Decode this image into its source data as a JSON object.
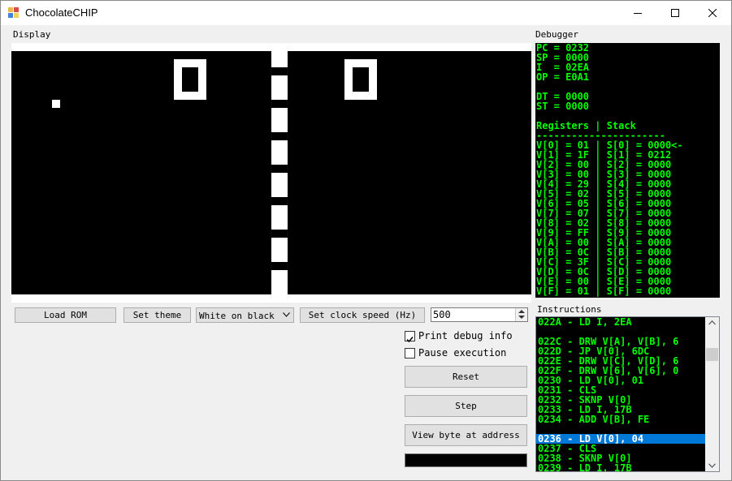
{
  "window": {
    "title": "ChocolateCHIP",
    "icon": "app-icon"
  },
  "sections": {
    "display": "Display",
    "debugger": "Debugger",
    "instructions": "Instructions"
  },
  "debugger": {
    "lines": [
      "PC = 0232",
      "SP = 0000",
      "I  = 02EA",
      "OP = E0A1",
      "",
      "DT = 0000",
      "ST = 0000",
      "",
      "Registers | Stack",
      "----------------------",
      "V[0] = 01 | S[0] = 0000<-",
      "V[1] = 1F | S[1] = 0212",
      "V[2] = 00 | S[2] = 0000",
      "V[3] = 00 | S[3] = 0000",
      "V[4] = 29 | S[4] = 0000",
      "V[5] = 02 | S[5] = 0000",
      "V[6] = 05 | S[6] = 0000",
      "V[7] = 07 | S[7] = 0000",
      "V[8] = 02 | S[8] = 0000",
      "V[9] = FF | S[9] = 0000",
      "V[A] = 00 | S[A] = 0000",
      "V[B] = 0C | S[B] = 0000",
      "V[C] = 3F | S[C] = 0000",
      "V[D] = 0C | S[D] = 0000",
      "V[E] = 00 | S[E] = 0000",
      "V[F] = 01 | S[F] = 0000"
    ]
  },
  "toolbar": {
    "load_rom": "Load ROM",
    "set_theme": "Set theme",
    "theme_selected": "White on black",
    "set_clock_speed": "Set clock speed (Hz)",
    "clock_speed_value": "500"
  },
  "controls": {
    "print_debug_info": "Print debug info",
    "print_debug_checked": true,
    "pause_execution": "Pause execution",
    "pause_checked": false,
    "reset": "Reset",
    "step": "Step",
    "view_byte": "View byte at address",
    "address_value": ""
  },
  "instructions": {
    "items": [
      "022A - LD I, 2EA",
      "",
      "022C - DRW V[A], V[B], 6",
      "022D - JP V[0], 6DC",
      "022E - DRW V[C], V[D], 6",
      "022F - DRW V[6], V[6], 0",
      "0230 - LD V[0], 01",
      "0231 - CLS",
      "0232 - SKNP V[0]",
      "0233 - LD I, 17B",
      "0234 - ADD V[B], FE",
      "",
      "0236 - LD V[0], 04",
      "0237 - CLS",
      "0238 - SKNP V[0]",
      "0239 - LD I, 17B"
    ],
    "selected_index": 12
  },
  "colors": {
    "terminal_green": "#00ff00",
    "terminal_bg": "#000000",
    "selection": "#0078d7",
    "pixel_on": "#ffffff"
  }
}
